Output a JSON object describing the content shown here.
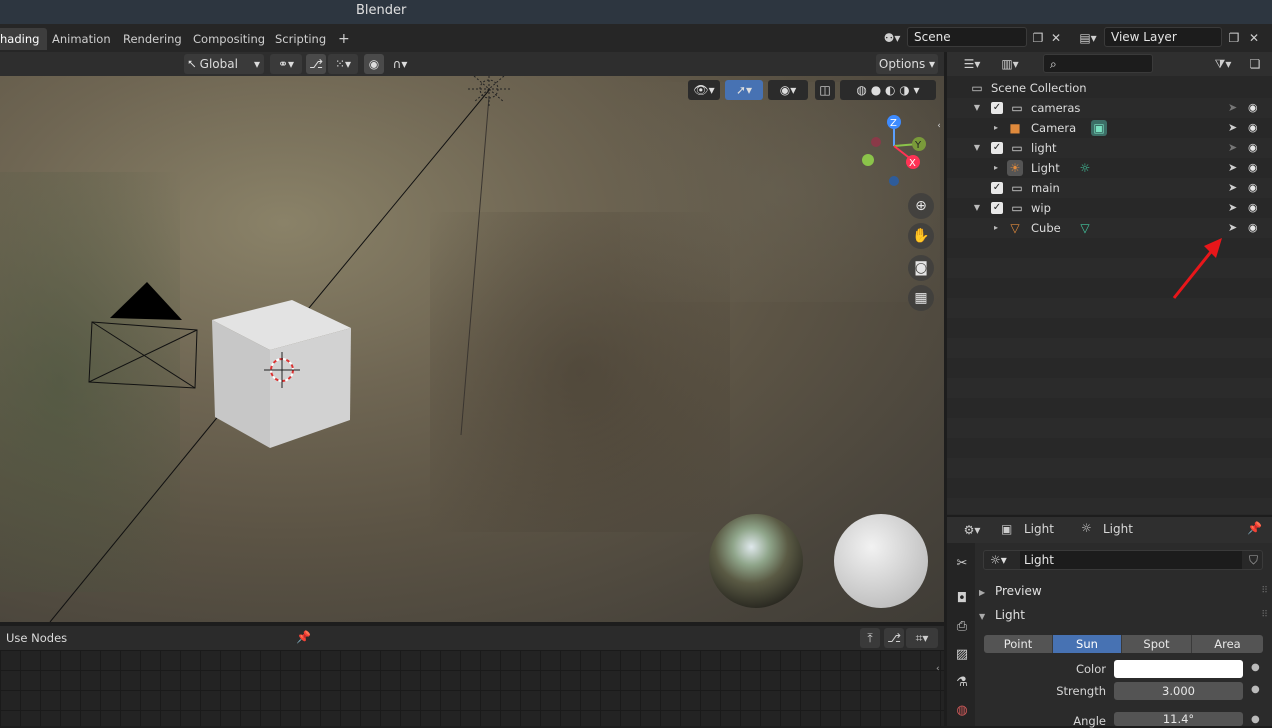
{
  "window": {
    "title": "Blender"
  },
  "workspace_tabs": [
    "hading",
    "Animation",
    "Rendering",
    "Compositing",
    "Scripting"
  ],
  "workspace_add": "+",
  "scene": {
    "name": "Scene",
    "view_layer": "View Layer"
  },
  "viewport": {
    "orientation": "Global",
    "options_label": "Options",
    "gizmo": {
      "z": "Z",
      "y": "Y",
      "x": "X"
    }
  },
  "node_editor": {
    "use_nodes_label": "Use Nodes"
  },
  "outliner": {
    "root": "Scene Collection",
    "rows": [
      {
        "label": "cameras",
        "type": "collection",
        "indent": 1,
        "expanded": true
      },
      {
        "label": "Camera",
        "type": "camera",
        "indent": 2
      },
      {
        "label": "light",
        "type": "collection",
        "indent": 1,
        "expanded": true
      },
      {
        "label": "Light",
        "type": "light",
        "indent": 2
      },
      {
        "label": "main",
        "type": "collection",
        "indent": 1
      },
      {
        "label": "wip",
        "type": "collection",
        "indent": 1,
        "expanded": true
      },
      {
        "label": "Cube",
        "type": "mesh",
        "indent": 2
      }
    ]
  },
  "properties": {
    "header_object": "Light",
    "header_data": "Light",
    "datablock_name": "Light",
    "panels": {
      "preview": "Preview",
      "light": "Light"
    },
    "light_types": [
      "Point",
      "Sun",
      "Spot",
      "Area"
    ],
    "active_type": "Sun",
    "color_label": "Color",
    "color_value": "#ffffff",
    "strength_label": "Strength",
    "strength_value": "3.000",
    "angle_label": "Angle",
    "angle_value": "11.4°"
  },
  "colors": {
    "accent": "#4772b3",
    "annotation_arrow": "#e8161a",
    "camera_icon": "#e08a3c",
    "light_data": "#43c8a0"
  }
}
